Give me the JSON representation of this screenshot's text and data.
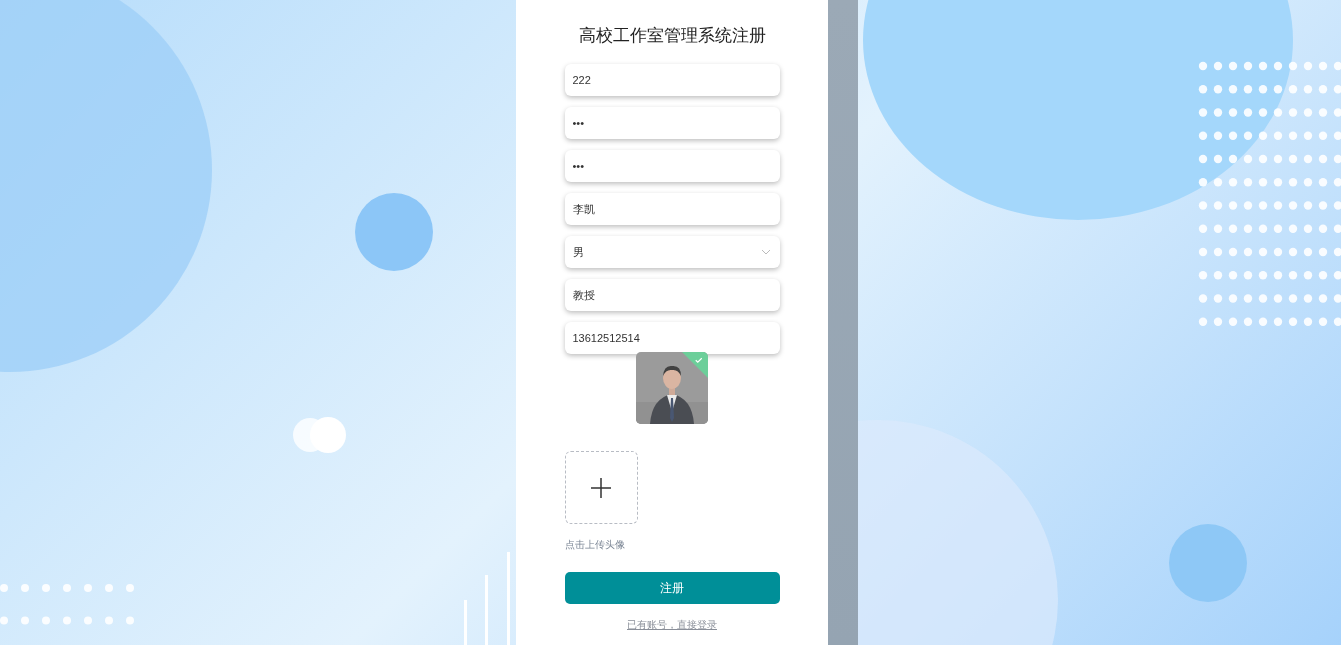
{
  "title": "高校工作室管理系统注册",
  "fields": [
    {
      "kind": "text",
      "value": "222"
    },
    {
      "kind": "text",
      "value": "•••"
    },
    {
      "kind": "text",
      "value": "•••"
    },
    {
      "kind": "text",
      "value": "李凯"
    },
    {
      "kind": "select",
      "value": "男"
    },
    {
      "kind": "text",
      "value": "教授"
    },
    {
      "kind": "text",
      "value": "13612512514"
    }
  ],
  "avatar": {
    "kind": "picture",
    "success": true
  },
  "upload": {
    "hint": "点击上传头像"
  },
  "submit": "注册",
  "login_link": "已有账号，直接登录"
}
